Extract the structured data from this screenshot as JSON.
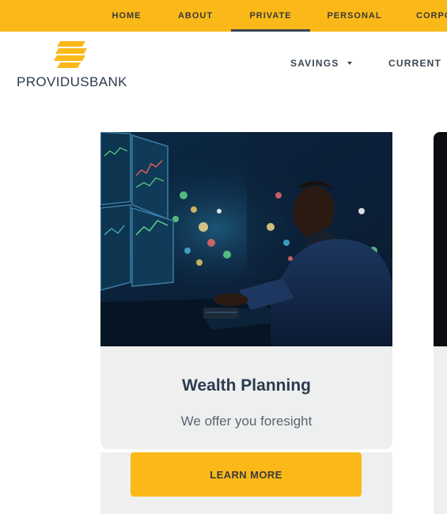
{
  "top_nav": {
    "items": [
      {
        "label": "HOME"
      },
      {
        "label": "ABOUT"
      },
      {
        "label": "PRIVATE",
        "active": true
      },
      {
        "label": "PERSONAL"
      },
      {
        "label": "CORPO"
      }
    ]
  },
  "brand": {
    "name": "PROVIDUSBANK",
    "logo_color": "#fbb919"
  },
  "main_nav": {
    "items": [
      {
        "label": "SAVINGS"
      },
      {
        "label": "CURRENT"
      }
    ]
  },
  "card": {
    "title": "Wealth Planning",
    "subtitle": "We offer you foresight",
    "button_label": "LEARN MORE"
  },
  "colors": {
    "accent": "#fbb919",
    "text_dark": "#2d3b4e",
    "card_bg": "#eef0f0"
  }
}
